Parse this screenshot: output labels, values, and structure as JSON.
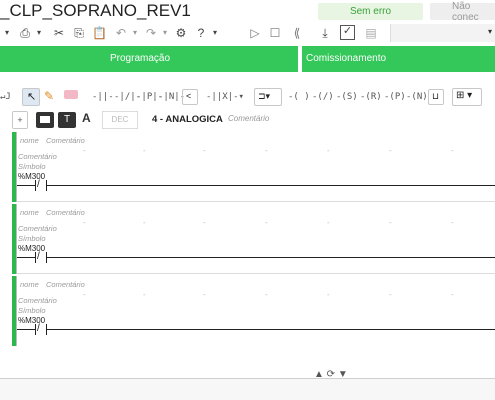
{
  "app": {
    "title": "_CLP_SOPRANO_REV1"
  },
  "status": {
    "ok_label": "Sem erro",
    "connection_label": "Não conec"
  },
  "sections": {
    "programming_label": "Programação",
    "commissioning_label": "Comissionamento"
  },
  "toolbar3": {
    "plus_label": "+",
    "dec_label": "DEC",
    "network_title": "4 - ANALOGICA",
    "network_comment": "Comentário"
  },
  "rungs": [
    {
      "name_label": "nome",
      "comment_label": "Comentário",
      "side_comment": "Comentário",
      "symbol_label": "Símbolo",
      "address": "%M300"
    },
    {
      "name_label": "nome",
      "comment_label": "Comentário",
      "side_comment": "Comentário",
      "symbol_label": "Símbolo",
      "address": "%M300"
    },
    {
      "name_label": "nome",
      "comment_label": "Comentário",
      "side_comment": "Comentário",
      "symbol_label": "Símbolo",
      "address": "%M300"
    }
  ],
  "toolbar_icons": {
    "row1": [
      "dropdown-arrow",
      "print-icon",
      "cut-icon",
      "copy-icon",
      "paste-icon",
      "undo-icon",
      "redo-icon",
      "settings-icon",
      "help-icon",
      "play-icon",
      "stop-icon",
      "rewind-icon",
      "download-icon",
      "checkbox-icon",
      "document-icon"
    ],
    "row2": [
      "pointer-icon",
      "pencil-icon",
      "eraser-icon",
      "no-contact-icon",
      "nc-contact-icon",
      "p-contact-icon",
      "n-contact-icon",
      "compare-icon",
      "parallel-icon",
      "block-icon",
      "coil-icon",
      "not-coil-icon",
      "set-coil-icon",
      "reset-coil-icon",
      "p-coil-icon",
      "n-coil-icon",
      "box-icon",
      "add-box-icon"
    ]
  },
  "bottom": {
    "handle_label": "▲ ⟳ ▼"
  }
}
